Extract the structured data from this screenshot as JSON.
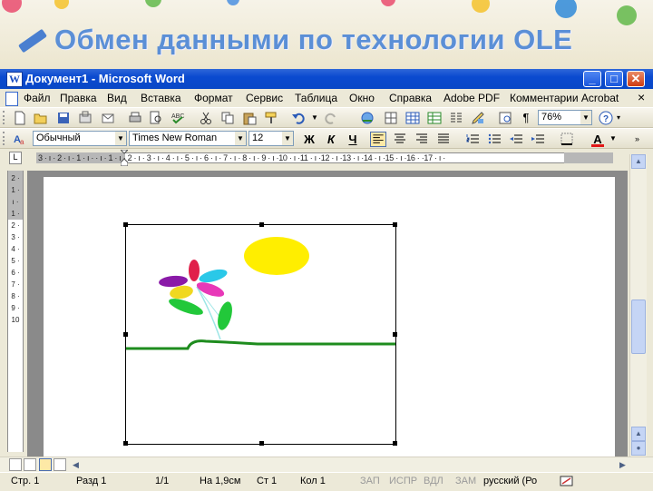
{
  "slide": {
    "title": "Обмен данными по технологии OLE"
  },
  "window": {
    "title": "Документ1 - Microsoft Word",
    "controls": {
      "minimize": "_",
      "maximize": "□",
      "close": "✕"
    }
  },
  "menu": {
    "items": [
      "Файл",
      "Правка",
      "Вид",
      "Вставка",
      "Формат",
      "Сервис",
      "Таблица",
      "Окно",
      "Справка",
      "Adobe PDF",
      "Комментарии Acrobat"
    ],
    "close_glyph": "×"
  },
  "toolbar": {
    "zoom": "76%",
    "icons": [
      "new-icon",
      "open-icon",
      "save-icon",
      "permission-icon",
      "print-preview-icon",
      "print-icon",
      "preview-icon",
      "spelling-icon",
      "cut-icon",
      "copy-icon",
      "paste-icon",
      "format-painter-icon",
      "undo-icon",
      "redo-icon",
      "hyperlink-icon",
      "tables-borders-icon",
      "insert-table-icon",
      "insert-excel-icon",
      "columns-icon",
      "drawing-icon",
      "document-map-icon",
      "show-formatting-icon",
      "help-icon"
    ]
  },
  "formatting": {
    "style": "Обычный",
    "font": "Times New Roman",
    "size": "12",
    "bold": "Ж",
    "italic": "К",
    "underline": "Ч",
    "font_color_label": "A"
  },
  "ruler": {
    "text": "3 · ı · 2 · ı · 1 · ı ·   · ı · 1 · ı · 2 · ı · 3 · ı · 4 · ı · 5 · ı · 6 · ı · 7 · ı · 8 · ı · 9 · ı ·10 · ı ·11 · ı ·12 · ı ·13 · ı ·14 · ı ·15 · ı ·16 ·   ·17 · ı ·",
    "tab_selector": "L",
    "vertical_text": "2 · 1 · ı · 1 · 2 · 3 · 4 · 5 · 6 · 7 · 8 · 9 ·10"
  },
  "drawing": {
    "colors": {
      "sun": "#ffee00",
      "grass": "#1e8c1e",
      "stem": "#9ee6e6",
      "petal_purple": "#8a1aa8",
      "petal_red": "#e0204a",
      "petal_cyan": "#2ac8e8",
      "petal_pink": "#e838b8",
      "petal_yellow": "#f0d820",
      "leaf": "#22c83a"
    }
  },
  "status": {
    "page": "Стр. 1",
    "section": "Разд 1",
    "pages": "1/1",
    "at": "На 1,9см",
    "line": "Ст 1",
    "col": "Кол 1",
    "rec": "ЗАП",
    "trk": "ИСПР",
    "ext": "ВДЛ",
    "ovr": "ЗАМ",
    "language": "русский (Ро"
  }
}
